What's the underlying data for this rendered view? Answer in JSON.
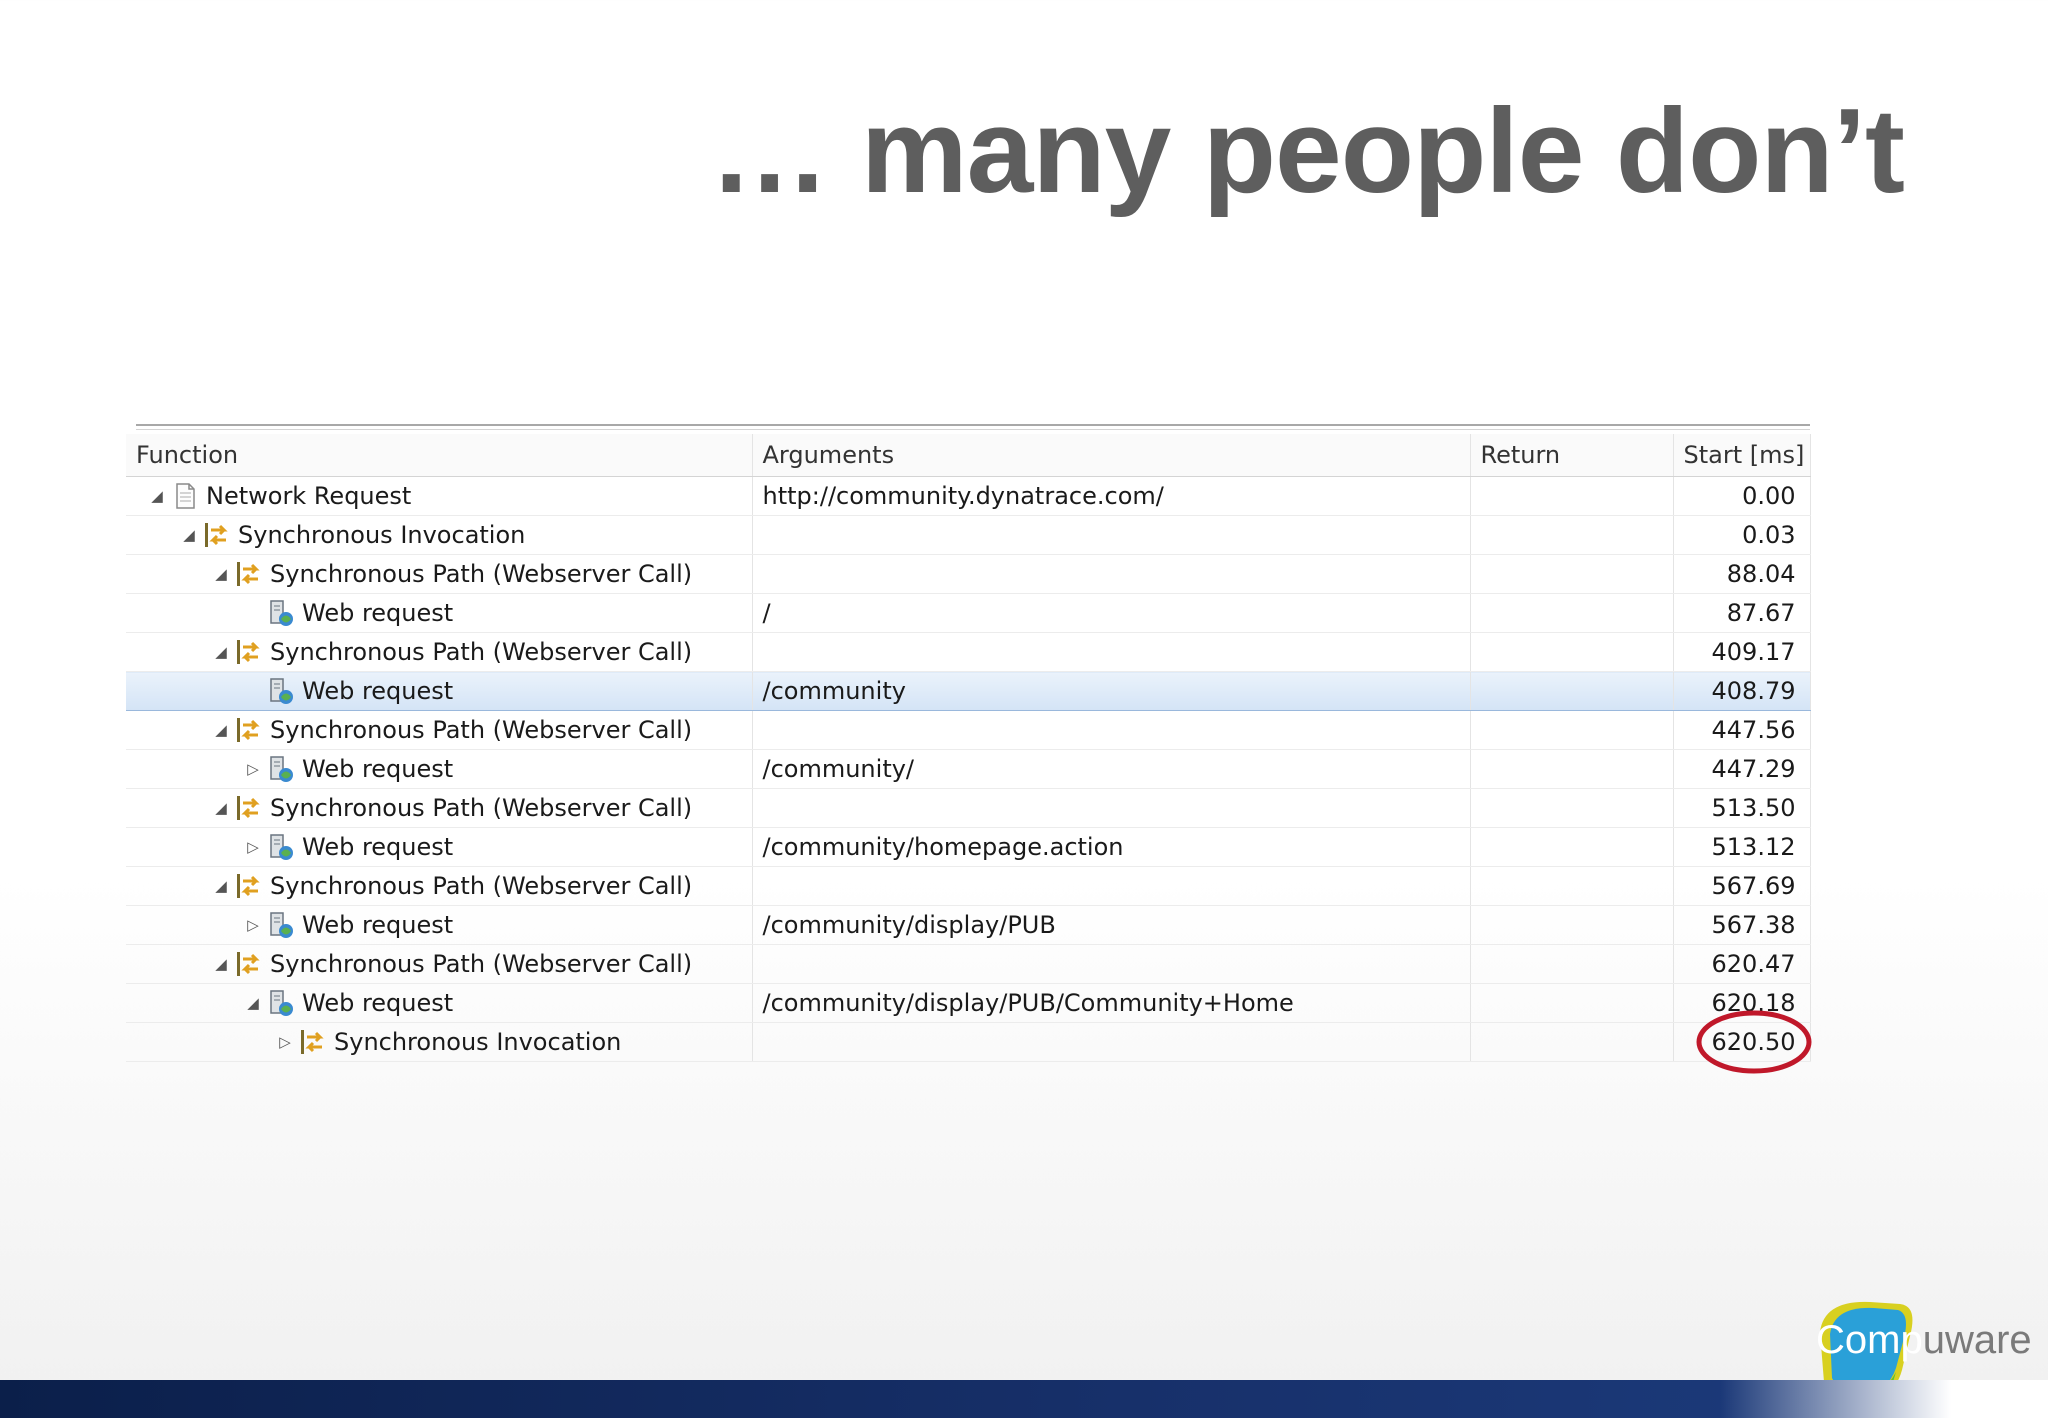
{
  "slide": {
    "title": "… many people don’t"
  },
  "grid": {
    "columns": [
      "Function",
      "Arguments",
      "Return",
      "Start [ms]"
    ],
    "rows": [
      {
        "expander": "expanded",
        "icon": "document-icon",
        "function": "Network Request",
        "arguments": "http://community.dynatrace.com/",
        "return": "",
        "start": "0.00"
      },
      {
        "expander": "expanded",
        "icon": "sync-arrows-icon",
        "function": "Synchronous Invocation",
        "arguments": "",
        "return": "",
        "start": "0.03"
      },
      {
        "expander": "expanded",
        "icon": "sync-arrows-icon",
        "function": "Synchronous Path (Webserver Call)",
        "arguments": "",
        "return": "",
        "start": "88.04"
      },
      {
        "expander": "none",
        "icon": "web-request-icon",
        "function": "Web request",
        "arguments": "/",
        "return": "",
        "start": "87.67"
      },
      {
        "expander": "expanded",
        "icon": "sync-arrows-icon",
        "function": "Synchronous Path (Webserver Call)",
        "arguments": "",
        "return": "",
        "start": "409.17"
      },
      {
        "expander": "none",
        "icon": "web-request-icon",
        "function": "Web request",
        "arguments": "/community",
        "return": "",
        "start": "408.79"
      },
      {
        "expander": "expanded",
        "icon": "sync-arrows-icon",
        "function": "Synchronous Path (Webserver Call)",
        "arguments": "",
        "return": "",
        "start": "447.56"
      },
      {
        "expander": "collapsed",
        "icon": "web-request-icon",
        "function": "Web request",
        "arguments": "/community/",
        "return": "",
        "start": "447.29"
      },
      {
        "expander": "expanded",
        "icon": "sync-arrows-icon",
        "function": "Synchronous Path (Webserver Call)",
        "arguments": "",
        "return": "",
        "start": "513.50"
      },
      {
        "expander": "collapsed",
        "icon": "web-request-icon",
        "function": "Web request",
        "arguments": "/community/homepage.action",
        "return": "",
        "start": "513.12"
      },
      {
        "expander": "expanded",
        "icon": "sync-arrows-icon",
        "function": "Synchronous Path (Webserver Call)",
        "arguments": "",
        "return": "",
        "start": "567.69"
      },
      {
        "expander": "collapsed",
        "icon": "web-request-icon",
        "function": "Web request",
        "arguments": "/community/display/PUB",
        "return": "",
        "start": "567.38"
      },
      {
        "expander": "expanded",
        "icon": "sync-arrows-icon",
        "function": "Synchronous Path (Webserver Call)",
        "arguments": "",
        "return": "",
        "start": "620.47"
      },
      {
        "expander": "expanded",
        "icon": "web-request-icon",
        "function": "Web request",
        "arguments": "/community/display/PUB/Community+Home",
        "return": "",
        "start": "620.18"
      },
      {
        "expander": "collapsed",
        "icon": "sync-arrows-icon",
        "function": "Synchronous Invocation",
        "arguments": "",
        "return": "",
        "start": "620.50"
      }
    ]
  },
  "branding": {
    "logo_text_first": "Comp",
    "logo_text_rest": "uware"
  },
  "colors": {
    "title": "#5e5e5e",
    "selection": "#d4e4f6",
    "highlight_circle": "#c0182a",
    "bottom_bar": "#17306a"
  }
}
